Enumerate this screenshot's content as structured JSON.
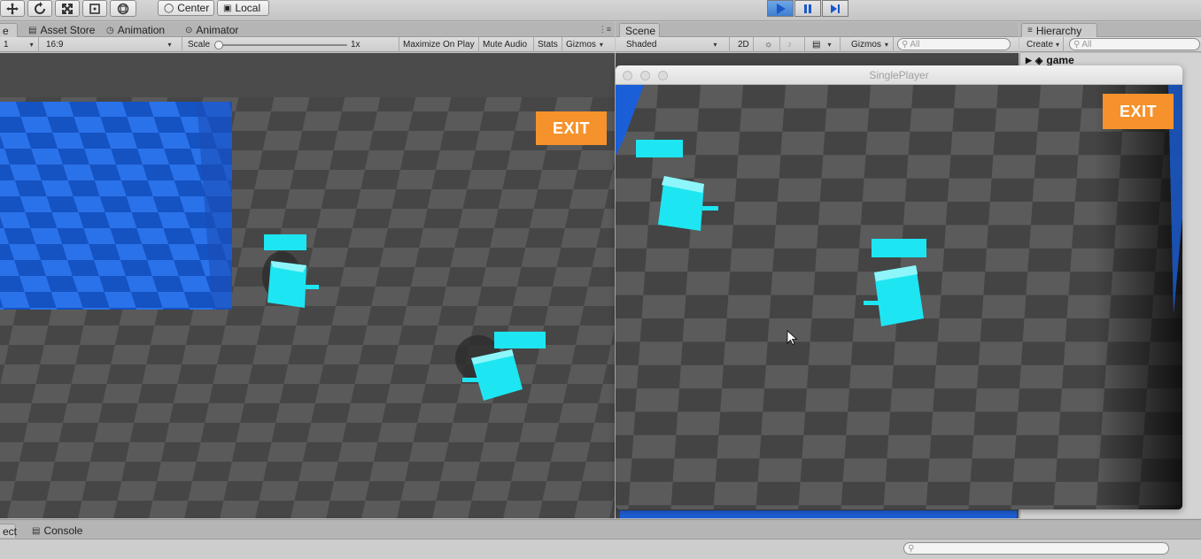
{
  "toolbar": {
    "pivot_center": "Center",
    "pivot_local": "Local",
    "icons": [
      "hand-move-icon",
      "rotate-icon",
      "scale-icon",
      "rect-tool-icon",
      "transform-icon",
      "play-icon",
      "pause-icon",
      "step-icon"
    ]
  },
  "game_panel": {
    "tabs": [
      {
        "label": "e"
      },
      {
        "label": "Asset Store"
      },
      {
        "label": "Animation"
      },
      {
        "label": "Animator"
      }
    ],
    "display": "1",
    "aspect": "16:9",
    "scale_label": "Scale",
    "scale_value": "1x",
    "maximize_on_play": "Maximize On Play",
    "mute_audio": "Mute Audio",
    "stats": "Stats",
    "gizmos": "Gizmos",
    "exit_button": "EXIT"
  },
  "scene_panel": {
    "tab": "Scene",
    "shading": "Shaded",
    "mode_2d": "2D",
    "gizmos": "Gizmos",
    "search_placeholder": "All"
  },
  "hierarchy_panel": {
    "tab": "Hierarchy",
    "create": "Create",
    "search_placeholder": "All",
    "root_item": "game"
  },
  "player_window": {
    "title": "SinglePlayer",
    "exit_button": "EXIT"
  },
  "bottom": {
    "tabs": [
      {
        "label": "ect"
      },
      {
        "label": "Console"
      }
    ]
  },
  "colors": {
    "accent_orange": "#f6922b",
    "cube_cyan": "#1de6f2",
    "wall_blue": "#1a5fd8",
    "floor_dark": "#454545",
    "floor_light": "#5c5c5c"
  }
}
